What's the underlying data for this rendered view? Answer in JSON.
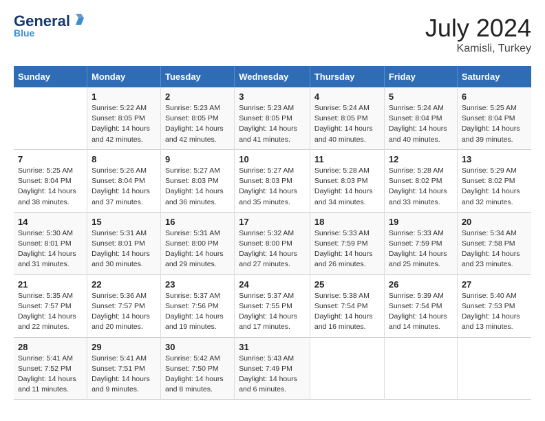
{
  "header": {
    "logo_general": "General",
    "logo_blue": "Blue",
    "month_year": "July 2024",
    "location": "Kamisli, Turkey"
  },
  "days_of_week": [
    "Sunday",
    "Monday",
    "Tuesday",
    "Wednesday",
    "Thursday",
    "Friday",
    "Saturday"
  ],
  "weeks": [
    [
      {
        "day": "",
        "sunrise": "",
        "sunset": "",
        "daylight": ""
      },
      {
        "day": "1",
        "sunrise": "Sunrise: 5:22 AM",
        "sunset": "Sunset: 8:05 PM",
        "daylight": "Daylight: 14 hours and 42 minutes."
      },
      {
        "day": "2",
        "sunrise": "Sunrise: 5:23 AM",
        "sunset": "Sunset: 8:05 PM",
        "daylight": "Daylight: 14 hours and 42 minutes."
      },
      {
        "day": "3",
        "sunrise": "Sunrise: 5:23 AM",
        "sunset": "Sunset: 8:05 PM",
        "daylight": "Daylight: 14 hours and 41 minutes."
      },
      {
        "day": "4",
        "sunrise": "Sunrise: 5:24 AM",
        "sunset": "Sunset: 8:05 PM",
        "daylight": "Daylight: 14 hours and 40 minutes."
      },
      {
        "day": "5",
        "sunrise": "Sunrise: 5:24 AM",
        "sunset": "Sunset: 8:04 PM",
        "daylight": "Daylight: 14 hours and 40 minutes."
      },
      {
        "day": "6",
        "sunrise": "Sunrise: 5:25 AM",
        "sunset": "Sunset: 8:04 PM",
        "daylight": "Daylight: 14 hours and 39 minutes."
      }
    ],
    [
      {
        "day": "7",
        "sunrise": "Sunrise: 5:25 AM",
        "sunset": "Sunset: 8:04 PM",
        "daylight": "Daylight: 14 hours and 38 minutes."
      },
      {
        "day": "8",
        "sunrise": "Sunrise: 5:26 AM",
        "sunset": "Sunset: 8:04 PM",
        "daylight": "Daylight: 14 hours and 37 minutes."
      },
      {
        "day": "9",
        "sunrise": "Sunrise: 5:27 AM",
        "sunset": "Sunset: 8:03 PM",
        "daylight": "Daylight: 14 hours and 36 minutes."
      },
      {
        "day": "10",
        "sunrise": "Sunrise: 5:27 AM",
        "sunset": "Sunset: 8:03 PM",
        "daylight": "Daylight: 14 hours and 35 minutes."
      },
      {
        "day": "11",
        "sunrise": "Sunrise: 5:28 AM",
        "sunset": "Sunset: 8:03 PM",
        "daylight": "Daylight: 14 hours and 34 minutes."
      },
      {
        "day": "12",
        "sunrise": "Sunrise: 5:28 AM",
        "sunset": "Sunset: 8:02 PM",
        "daylight": "Daylight: 14 hours and 33 minutes."
      },
      {
        "day": "13",
        "sunrise": "Sunrise: 5:29 AM",
        "sunset": "Sunset: 8:02 PM",
        "daylight": "Daylight: 14 hours and 32 minutes."
      }
    ],
    [
      {
        "day": "14",
        "sunrise": "Sunrise: 5:30 AM",
        "sunset": "Sunset: 8:01 PM",
        "daylight": "Daylight: 14 hours and 31 minutes."
      },
      {
        "day": "15",
        "sunrise": "Sunrise: 5:31 AM",
        "sunset": "Sunset: 8:01 PM",
        "daylight": "Daylight: 14 hours and 30 minutes."
      },
      {
        "day": "16",
        "sunrise": "Sunrise: 5:31 AM",
        "sunset": "Sunset: 8:00 PM",
        "daylight": "Daylight: 14 hours and 29 minutes."
      },
      {
        "day": "17",
        "sunrise": "Sunrise: 5:32 AM",
        "sunset": "Sunset: 8:00 PM",
        "daylight": "Daylight: 14 hours and 27 minutes."
      },
      {
        "day": "18",
        "sunrise": "Sunrise: 5:33 AM",
        "sunset": "Sunset: 7:59 PM",
        "daylight": "Daylight: 14 hours and 26 minutes."
      },
      {
        "day": "19",
        "sunrise": "Sunrise: 5:33 AM",
        "sunset": "Sunset: 7:59 PM",
        "daylight": "Daylight: 14 hours and 25 minutes."
      },
      {
        "day": "20",
        "sunrise": "Sunrise: 5:34 AM",
        "sunset": "Sunset: 7:58 PM",
        "daylight": "Daylight: 14 hours and 23 minutes."
      }
    ],
    [
      {
        "day": "21",
        "sunrise": "Sunrise: 5:35 AM",
        "sunset": "Sunset: 7:57 PM",
        "daylight": "Daylight: 14 hours and 22 minutes."
      },
      {
        "day": "22",
        "sunrise": "Sunrise: 5:36 AM",
        "sunset": "Sunset: 7:57 PM",
        "daylight": "Daylight: 14 hours and 20 minutes."
      },
      {
        "day": "23",
        "sunrise": "Sunrise: 5:37 AM",
        "sunset": "Sunset: 7:56 PM",
        "daylight": "Daylight: 14 hours and 19 minutes."
      },
      {
        "day": "24",
        "sunrise": "Sunrise: 5:37 AM",
        "sunset": "Sunset: 7:55 PM",
        "daylight": "Daylight: 14 hours and 17 minutes."
      },
      {
        "day": "25",
        "sunrise": "Sunrise: 5:38 AM",
        "sunset": "Sunset: 7:54 PM",
        "daylight": "Daylight: 14 hours and 16 minutes."
      },
      {
        "day": "26",
        "sunrise": "Sunrise: 5:39 AM",
        "sunset": "Sunset: 7:54 PM",
        "daylight": "Daylight: 14 hours and 14 minutes."
      },
      {
        "day": "27",
        "sunrise": "Sunrise: 5:40 AM",
        "sunset": "Sunset: 7:53 PM",
        "daylight": "Daylight: 14 hours and 13 minutes."
      }
    ],
    [
      {
        "day": "28",
        "sunrise": "Sunrise: 5:41 AM",
        "sunset": "Sunset: 7:52 PM",
        "daylight": "Daylight: 14 hours and 11 minutes."
      },
      {
        "day": "29",
        "sunrise": "Sunrise: 5:41 AM",
        "sunset": "Sunset: 7:51 PM",
        "daylight": "Daylight: 14 hours and 9 minutes."
      },
      {
        "day": "30",
        "sunrise": "Sunrise: 5:42 AM",
        "sunset": "Sunset: 7:50 PM",
        "daylight": "Daylight: 14 hours and 8 minutes."
      },
      {
        "day": "31",
        "sunrise": "Sunrise: 5:43 AM",
        "sunset": "Sunset: 7:49 PM",
        "daylight": "Daylight: 14 hours and 6 minutes."
      },
      {
        "day": "",
        "sunrise": "",
        "sunset": "",
        "daylight": ""
      },
      {
        "day": "",
        "sunrise": "",
        "sunset": "",
        "daylight": ""
      },
      {
        "day": "",
        "sunrise": "",
        "sunset": "",
        "daylight": ""
      }
    ]
  ]
}
